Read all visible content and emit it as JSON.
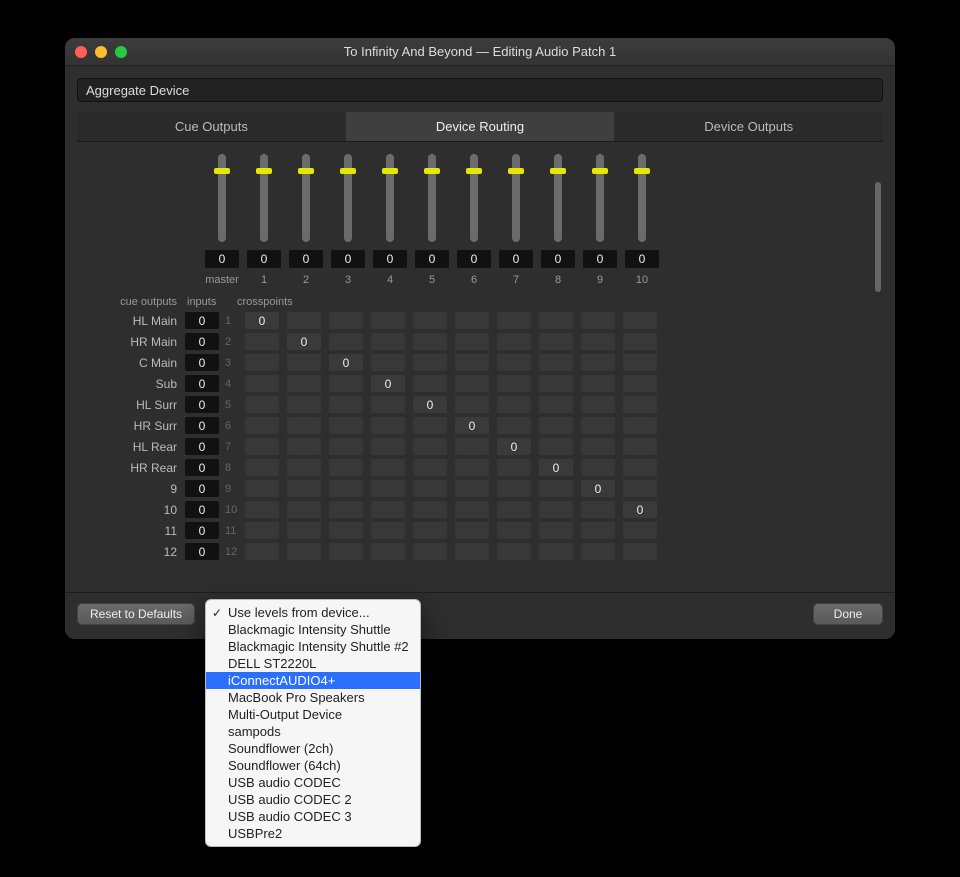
{
  "window": {
    "title": "To Infinity And Beyond — Editing Audio Patch 1"
  },
  "device_field": "Aggregate Device",
  "tabs": [
    {
      "label": "Cue Outputs",
      "active": false
    },
    {
      "label": "Device Routing",
      "active": true
    },
    {
      "label": "Device Outputs",
      "active": false
    }
  ],
  "section_labels": {
    "cue": "cue outputs",
    "inputs": "inputs",
    "crosspoints": "crosspoints"
  },
  "columns": [
    {
      "label": "master",
      "value": "0"
    },
    {
      "label": "1",
      "value": "0"
    },
    {
      "label": "2",
      "value": "0"
    },
    {
      "label": "3",
      "value": "0"
    },
    {
      "label": "4",
      "value": "0"
    },
    {
      "label": "5",
      "value": "0"
    },
    {
      "label": "6",
      "value": "0"
    },
    {
      "label": "7",
      "value": "0"
    },
    {
      "label": "8",
      "value": "0"
    },
    {
      "label": "9",
      "value": "0"
    },
    {
      "label": "10",
      "value": "0"
    }
  ],
  "rows": [
    {
      "label": "HL Main",
      "input": "0",
      "idx": "1",
      "cross": [
        "0",
        "",
        "",
        "",
        "",
        "",
        "",
        "",
        "",
        ""
      ]
    },
    {
      "label": "HR Main",
      "input": "0",
      "idx": "2",
      "cross": [
        "",
        "0",
        "",
        "",
        "",
        "",
        "",
        "",
        "",
        ""
      ]
    },
    {
      "label": "C Main",
      "input": "0",
      "idx": "3",
      "cross": [
        "",
        "",
        "0",
        "",
        "",
        "",
        "",
        "",
        "",
        ""
      ]
    },
    {
      "label": "Sub",
      "input": "0",
      "idx": "4",
      "cross": [
        "",
        "",
        "",
        "0",
        "",
        "",
        "",
        "",
        "",
        ""
      ]
    },
    {
      "label": "HL Surr",
      "input": "0",
      "idx": "5",
      "cross": [
        "",
        "",
        "",
        "",
        "0",
        "",
        "",
        "",
        "",
        ""
      ]
    },
    {
      "label": "HR Surr",
      "input": "0",
      "idx": "6",
      "cross": [
        "",
        "",
        "",
        "",
        "",
        "0",
        "",
        "",
        "",
        ""
      ]
    },
    {
      "label": "HL Rear",
      "input": "0",
      "idx": "7",
      "cross": [
        "",
        "",
        "",
        "",
        "",
        "",
        "0",
        "",
        "",
        ""
      ]
    },
    {
      "label": "HR Rear",
      "input": "0",
      "idx": "8",
      "cross": [
        "",
        "",
        "",
        "",
        "",
        "",
        "",
        "0",
        "",
        ""
      ]
    },
    {
      "label": "9",
      "input": "0",
      "idx": "9",
      "cross": [
        "",
        "",
        "",
        "",
        "",
        "",
        "",
        "",
        "0",
        ""
      ]
    },
    {
      "label": "10",
      "input": "0",
      "idx": "10",
      "cross": [
        "",
        "",
        "",
        "",
        "",
        "",
        "",
        "",
        "",
        "0"
      ]
    },
    {
      "label": "11",
      "input": "0",
      "idx": "11",
      "cross": [
        "",
        "",
        "",
        "",
        "",
        "",
        "",
        "",
        "",
        ""
      ]
    },
    {
      "label": "12",
      "input": "0",
      "idx": "12",
      "cross": [
        "",
        "",
        "",
        "",
        "",
        "",
        "",
        "",
        "",
        ""
      ]
    }
  ],
  "footer": {
    "reset": "Reset to Defaults",
    "done": "Done"
  },
  "popup": {
    "checked_index": 0,
    "selected_index": 4,
    "items": [
      "Use levels from device...",
      "Blackmagic Intensity Shuttle",
      "Blackmagic Intensity Shuttle #2",
      "DELL ST2220L",
      "iConnectAUDIO4+",
      "MacBook Pro Speakers",
      "Multi-Output Device",
      "sampods",
      "Soundflower (2ch)",
      "Soundflower (64ch)",
      "USB audio CODEC",
      "USB audio CODEC 2",
      "USB audio CODEC 3",
      "USBPre2"
    ]
  }
}
